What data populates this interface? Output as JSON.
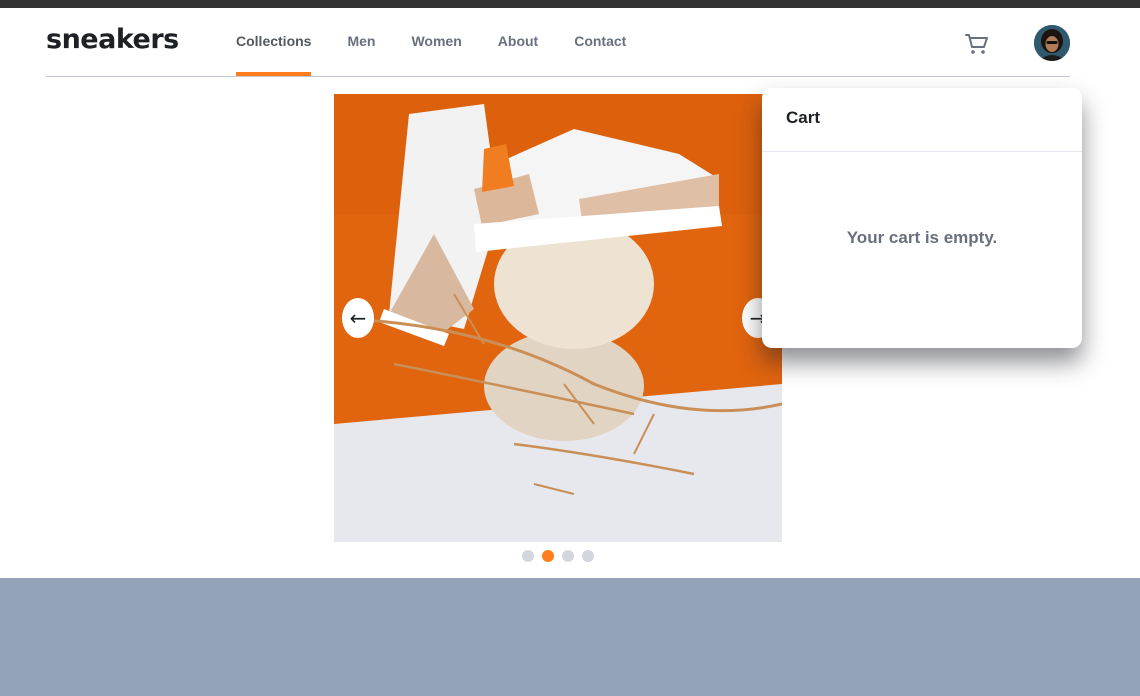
{
  "brand": {
    "logo_text": "sneakers"
  },
  "nav": {
    "items": [
      {
        "label": "Collections",
        "active": true
      },
      {
        "label": "Men"
      },
      {
        "label": "Women"
      },
      {
        "label": "About"
      },
      {
        "label": "Contact"
      }
    ]
  },
  "header": {
    "cart_icon": "cart-icon",
    "avatar_icon": "user-avatar"
  },
  "gallery": {
    "prev_glyph": "←",
    "next_glyph": "→",
    "slide_count": 4,
    "active_slide": 2
  },
  "cart": {
    "title": "Cart",
    "empty_message": "Your cart is empty."
  },
  "colors": {
    "accent": "#ff7d1a",
    "footer": "#95a3ba",
    "text_dark": "#1d2025",
    "text_gray": "#69707d"
  }
}
